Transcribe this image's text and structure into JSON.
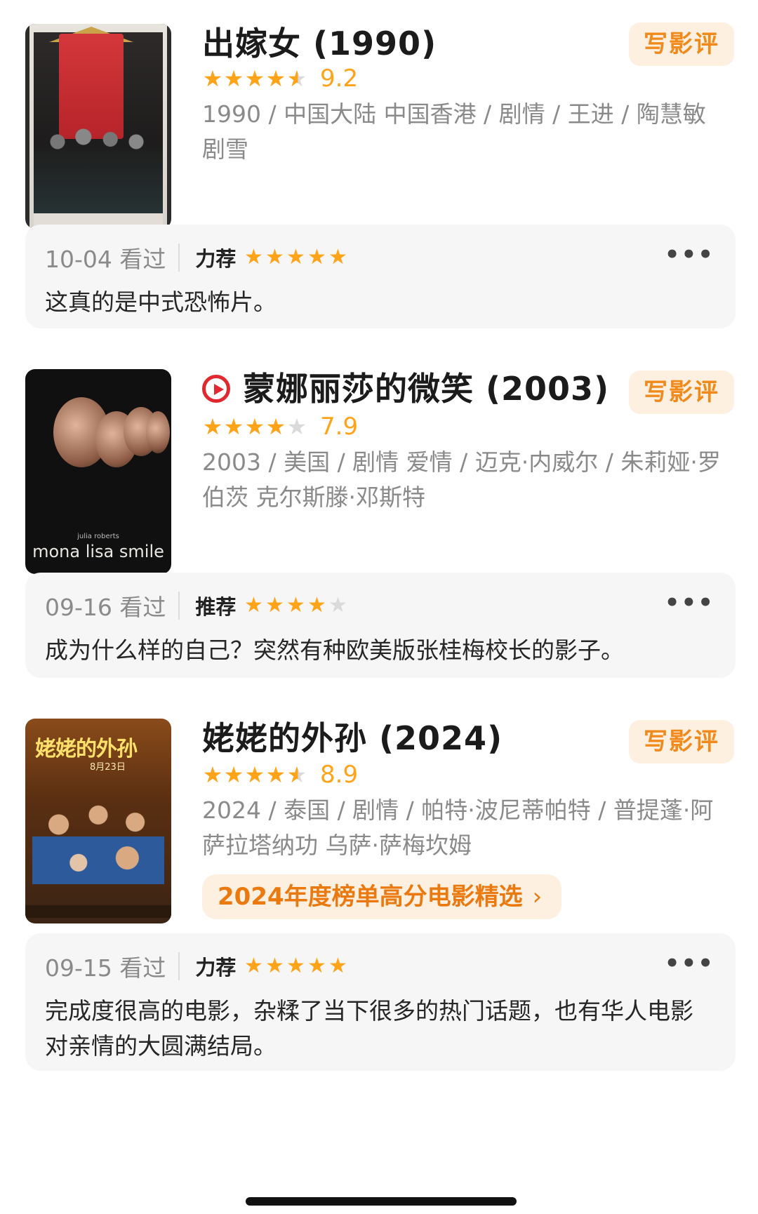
{
  "write_review_label": "写影评",
  "more_label": "•••",
  "movies": [
    {
      "title": "出嫁女 (1990)",
      "score": "9.2",
      "stars": 4.5,
      "meta": "1990 / 中国大陆 中国香港 / 剧情 / 王进 / 陶慧敏 剧雪",
      "has_play": false,
      "review": {
        "date": "10-04 看过",
        "tag": "力荐",
        "stars": 5,
        "text": "这真的是中式恐怖片。"
      }
    },
    {
      "title": "蒙娜丽莎的微笑 (2003)",
      "score": "7.9",
      "stars": 4,
      "meta": "2003 / 美国 / 剧情 爱情 / 迈克·内威尔 / 朱莉娅·罗伯茨 克尔斯滕·邓斯特",
      "has_play": true,
      "poster_text": "mona lisa smile",
      "poster_small": "julia roberts",
      "review": {
        "date": "09-16 看过",
        "tag": "推荐",
        "stars": 4,
        "text": "成为什么样的自己？突然有种欧美版张桂梅校长的影子。"
      }
    },
    {
      "title": "姥姥的外孙 (2024)",
      "score": "8.9",
      "stars": 4.5,
      "meta": "2024 / 泰国 / 剧情 / 帕特·波尼蒂帕特 / 普提蓬·阿萨拉塔纳功 乌萨·萨梅坎姆",
      "has_play": false,
      "poster_title": "姥姥的外孙",
      "poster_date": "8月23日",
      "promo": "2024年度榜单高分电影精选",
      "review": {
        "date": "09-15 看过",
        "tag": "力荐",
        "stars": 5,
        "text": "完成度很高的电影，杂糅了当下很多的热门话题，也有华人电影对亲情的大圆满结局。"
      }
    }
  ]
}
